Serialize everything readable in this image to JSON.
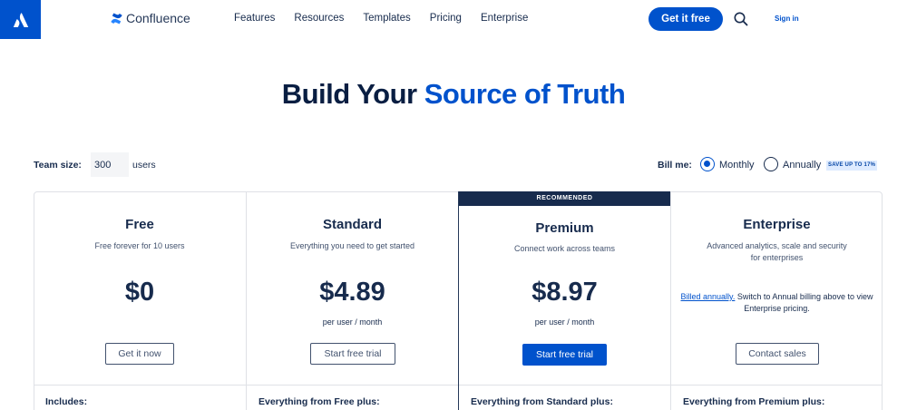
{
  "nav": {
    "brand": "Confluence",
    "links": [
      "Features",
      "Resources",
      "Templates",
      "Pricing",
      "Enterprise"
    ],
    "cta": "Get it free",
    "sign_in": "Sign in"
  },
  "hero": {
    "title_plain": "Build Your",
    "title_accent": "Source of Truth"
  },
  "controls": {
    "team_size_label": "Team size:",
    "team_size_value": "300",
    "users_label": "users",
    "bill_label": "Bill me:",
    "monthly": "Monthly",
    "annually": "Annually",
    "save_badge": "SAVE UP TO 17%",
    "selected": "Monthly"
  },
  "recommended": "RECOMMENDED",
  "plans": [
    {
      "name": "Free",
      "desc": "Free forever for 10 users",
      "price": "$0",
      "per": "",
      "button": "Get it now",
      "includes": "Includes:"
    },
    {
      "name": "Standard",
      "desc": "Everything you need to get started",
      "price": "$4.89",
      "per": "per user / month",
      "button": "Start free trial",
      "includes": "Everything from Free plus:"
    },
    {
      "name": "Premium",
      "desc": "Connect work across teams",
      "price": "$8.97",
      "per": "per user / month",
      "button": "Start free trial",
      "includes": "Everything from Standard plus:"
    },
    {
      "name": "Enterprise",
      "desc": "Advanced analytics, scale and security for enterprises",
      "price": "",
      "per": "",
      "button": "Contact sales",
      "includes": "Everything from Premium plus:",
      "note_link": "Billed annually.",
      "note_text": " Switch to Annual billing above to view Enterprise pricing."
    }
  ],
  "colors": {
    "brand": "#0052cc",
    "dark": "#172b4d",
    "border": "#dfe1e6"
  }
}
